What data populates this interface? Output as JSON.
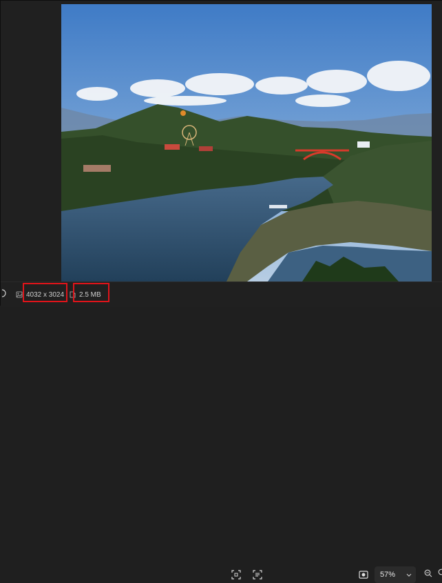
{
  "image": {
    "alt": "Lake landscape with forested hills, a red arch bridge and a Ferris wheel"
  },
  "status_bar": {
    "dimensions": "4032 x 3024",
    "file_size": "2.5 MB",
    "zoom": "57%",
    "icons": {
      "dimensions": "image-dimensions-icon",
      "file_size": "file-size-icon",
      "ai_select": "focus-select-icon",
      "text_extract": "text-extract-icon",
      "view_mode": "view-mode-icon",
      "zoom_dropdown": "chevron-down-icon",
      "zoom_out": "zoom-out-icon"
    }
  },
  "colors": {
    "highlight": "#e0141a",
    "background": "#1f1f1f"
  }
}
